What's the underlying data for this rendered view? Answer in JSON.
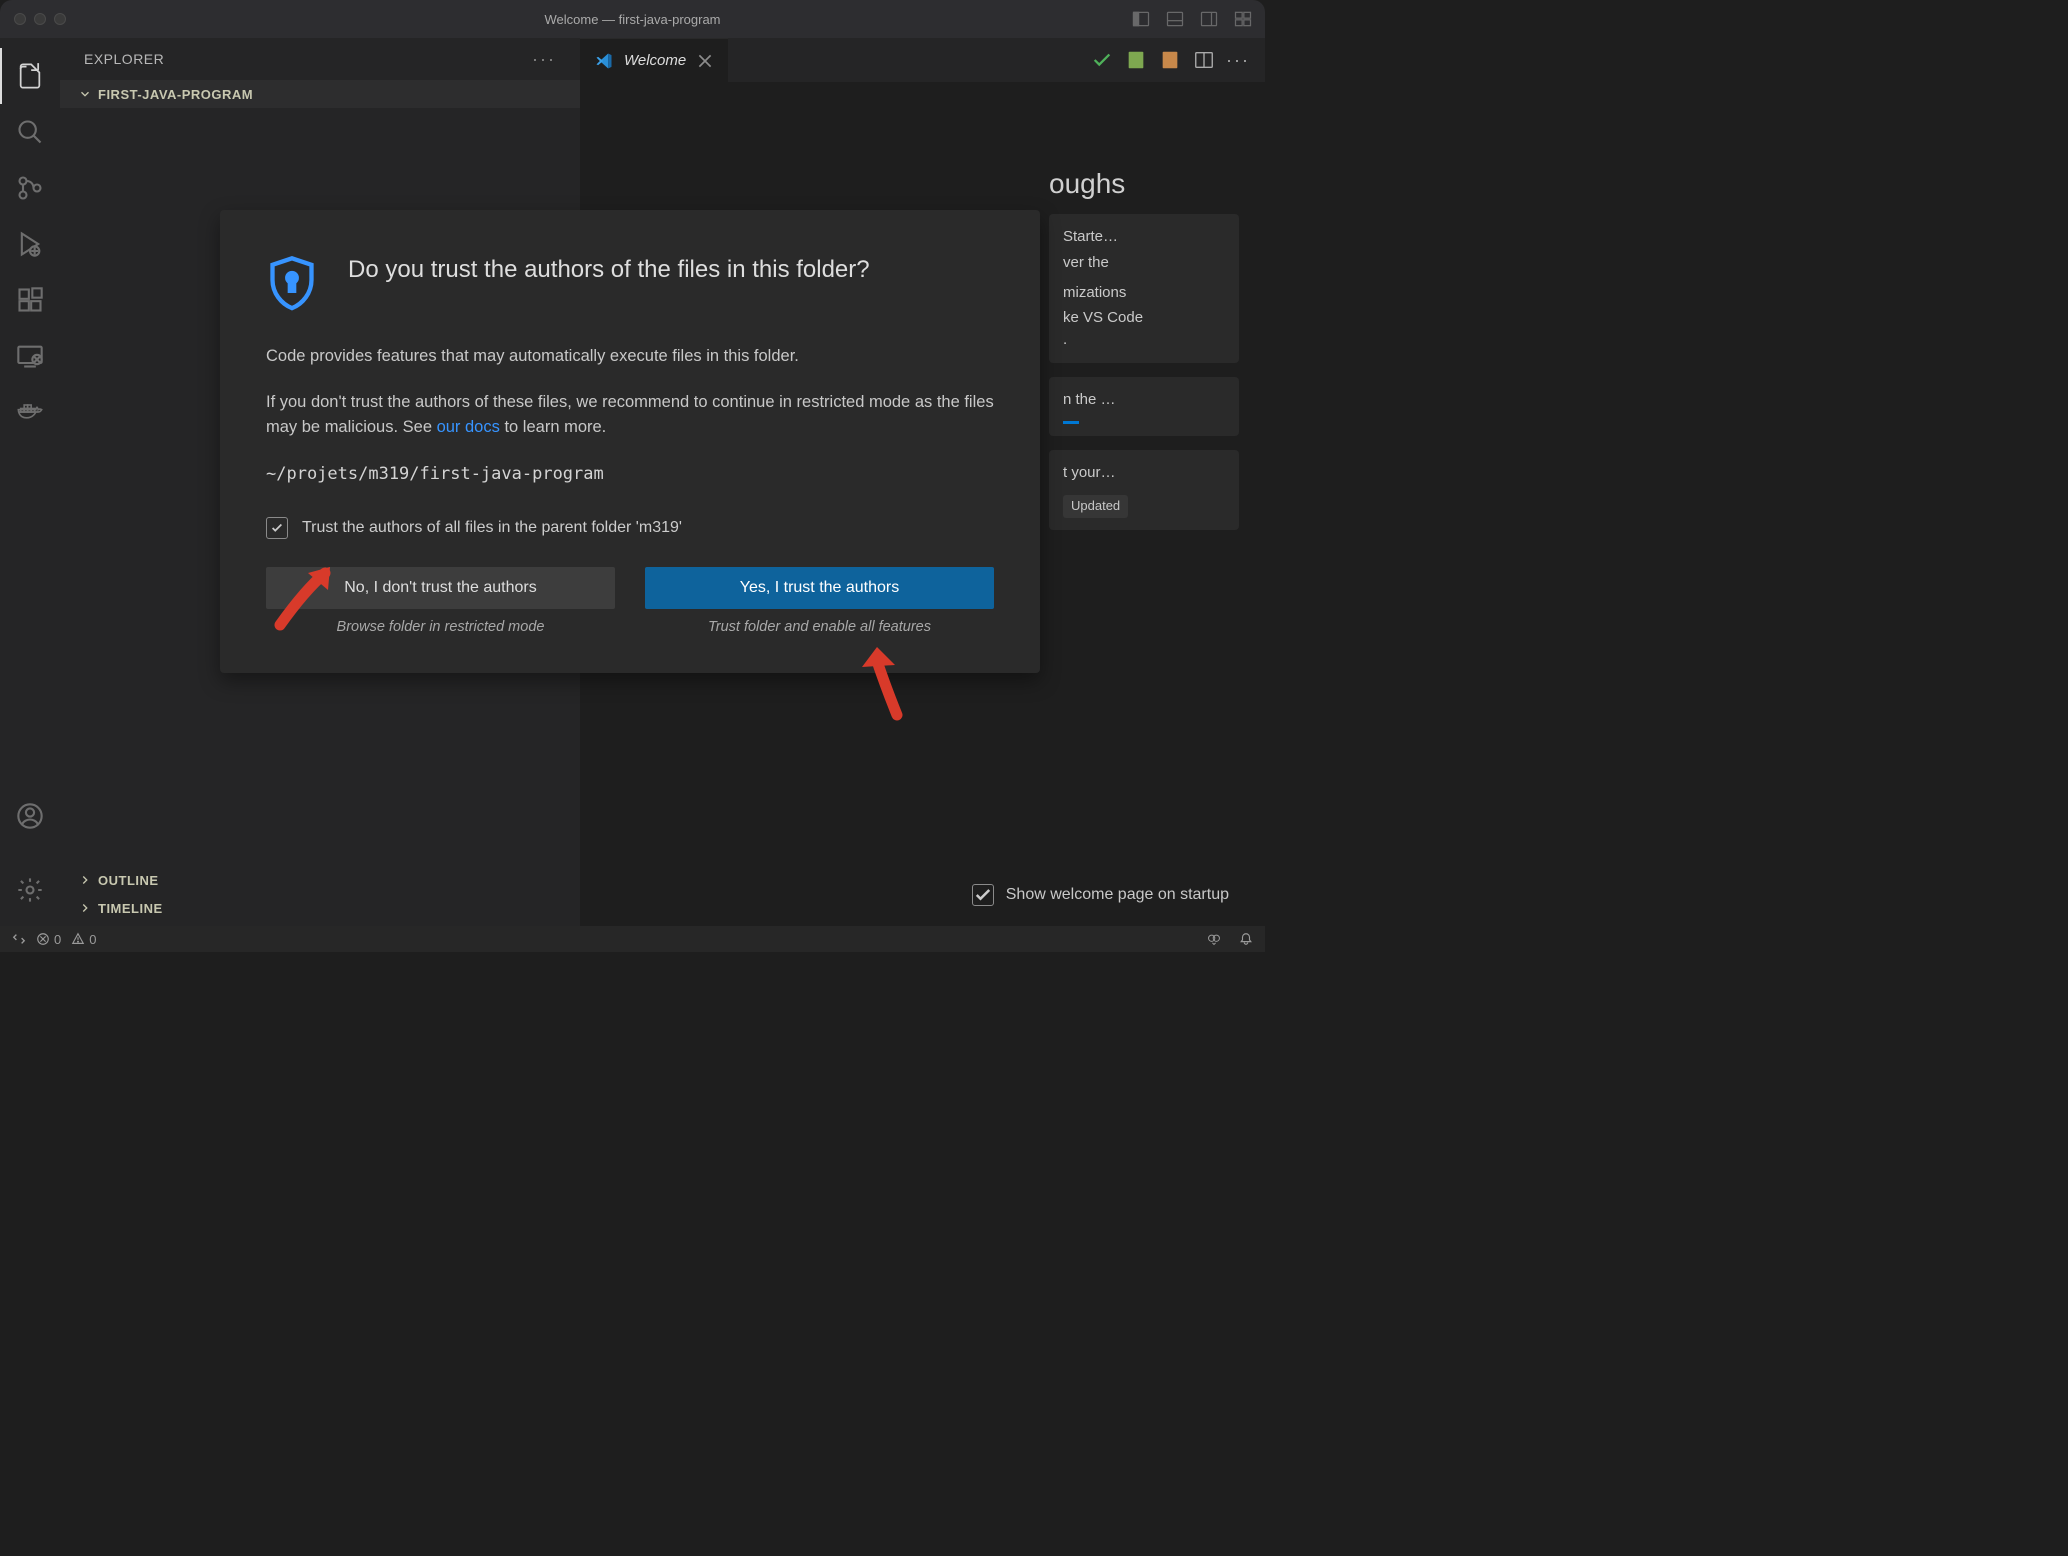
{
  "window": {
    "title": "Welcome — first-java-program"
  },
  "explorer": {
    "header": "EXPLORER",
    "folder": "FIRST-JAVA-PROGRAM",
    "sections": [
      "OUTLINE",
      "TIMELINE"
    ]
  },
  "tab": {
    "label": "Welcome"
  },
  "walkthroughs": {
    "heading": "oughs",
    "card1": {
      "title": "Starte…",
      "body": "ver the"
    },
    "card2": {
      "title": "mizations",
      "body": "ke VS Code"
    },
    "card3": {
      "title": "n the …"
    },
    "card4": {
      "title": "t your…",
      "updated": "Updated"
    }
  },
  "startup_check": "Show welcome page on startup",
  "dialog": {
    "title": "Do you trust the authors of the files in this folder?",
    "p1": "Code provides features that may automatically execute files in this folder.",
    "p2a": "If you don't trust the authors of these files, we recommend to continue in restricted mode as the files may be malicious. See ",
    "p2link": "our docs",
    "p2b": " to learn more.",
    "path": "~/projets/m319/first-java-program",
    "checkbox": "Trust the authors of all files in the parent folder 'm319'",
    "btnNo": "No, I don't trust the authors",
    "btnNoSub": "Browse folder in restricted mode",
    "btnYes": "Yes, I trust the authors",
    "btnYesSub": "Trust folder and enable all features"
  },
  "statusbar": {
    "errors": "0",
    "warnings": "0"
  }
}
